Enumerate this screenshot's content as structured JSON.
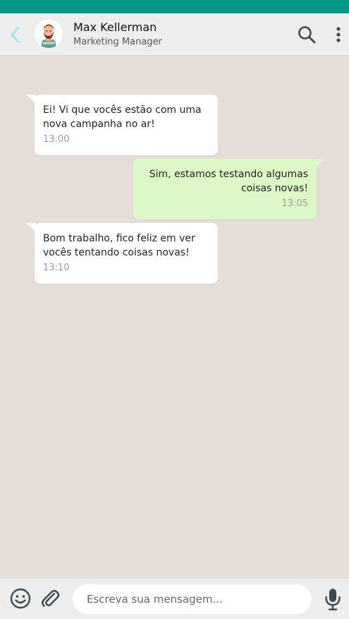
{
  "header": {
    "contact_name": "Max Kellerman",
    "contact_role": "Marketing Manager",
    "back_icon": "chevron-left-icon",
    "search_icon": "search-icon",
    "menu_icon": "more-vertical-icon"
  },
  "colors": {
    "status_bar": "#009688",
    "header_bg": "#ededed",
    "chat_bg": "#e5ddd8",
    "incoming_bubble": "#ffffff",
    "outgoing_bubble": "#dcf8c6",
    "back_icon": "#a7e6ef"
  },
  "messages": [
    {
      "direction": "incoming",
      "text": "Ei! Vi que vocês estão com uma nova campanha no ar!",
      "time": "13:00"
    },
    {
      "direction": "outgoing",
      "text": "Sim, estamos testando algumas coisas novas!",
      "time": "13:05"
    },
    {
      "direction": "incoming",
      "text": "Bom trabalho, fico feliz em ver vocês tentando coisas novas!",
      "time": "13:10"
    }
  ],
  "composer": {
    "placeholder": "Escreva sua mensagem...",
    "value": "",
    "emoji_icon": "smiley-icon",
    "attach_icon": "paperclip-icon",
    "mic_icon": "microphone-icon"
  }
}
